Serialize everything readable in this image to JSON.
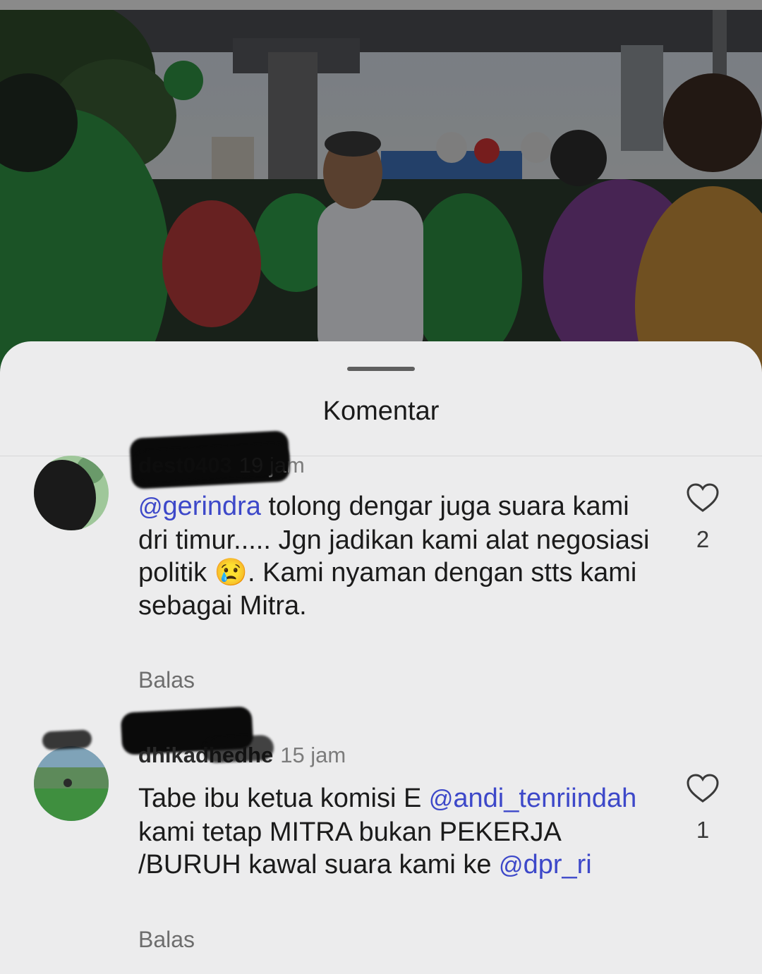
{
  "sheet": {
    "title": "Komentar"
  },
  "comments": [
    {
      "username": "dest0403",
      "time": "19 jam",
      "segments": [
        {
          "type": "mention",
          "text": "gerindra"
        },
        {
          "type": "text",
          "text": "  tolong dengar juga suara kami dri timur..... Jgn jadikan kami alat negosiasi politik "
        },
        {
          "type": "emoji",
          "text": "😢"
        },
        {
          "type": "text",
          "text": ". Kami nyaman dengan stts kami sebagai Mitra."
        }
      ],
      "reply_label": "Balas",
      "likes": "2"
    },
    {
      "username": "dhikadhedhe",
      "time": "15 jam",
      "segments": [
        {
          "type": "text",
          "text": "Tabe ibu ketua komisi E "
        },
        {
          "type": "mention",
          "text": "andi_tenriindah"
        },
        {
          "type": "text",
          "text": "  kami tetap MITRA bukan PEKERJA /BURUH kawal suara kami ke "
        },
        {
          "type": "mention",
          "text": "dpr_ri"
        }
      ],
      "reply_label": "Balas",
      "likes": "1"
    }
  ],
  "colors": {
    "mention": "#3d48c9",
    "sheet_background": "#ececed"
  },
  "icons": {
    "like": "heart-outline-icon",
    "mention_prefix": "@"
  }
}
